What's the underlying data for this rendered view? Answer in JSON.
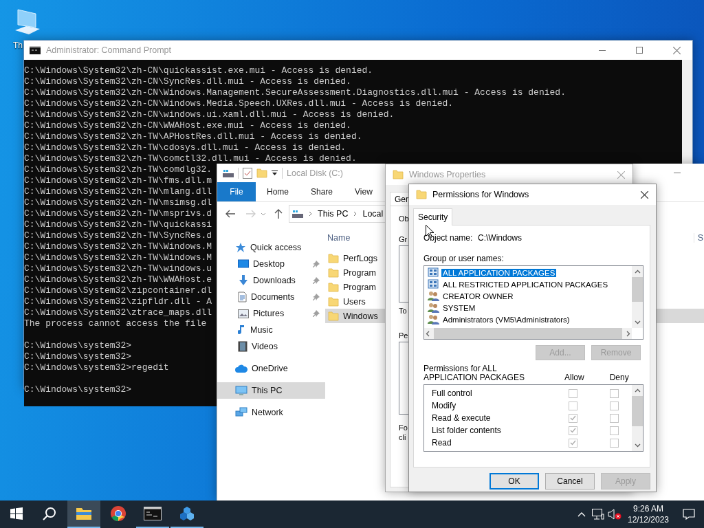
{
  "desktop_icons": [
    {
      "label": "Th"
    }
  ],
  "command_prompt": {
    "title": "Administrator: Command Prompt",
    "blocks": [
      [
        "C:\\Windows\\System32\\zh-CN\\quickassist.exe.mui - Access is denied.",
        "C:\\Windows\\System32\\zh-CN\\SyncRes.dll.mui - Access is denied.",
        "C:\\Windows\\System32\\zh-CN\\Windows.Management.SecureAssessment.Diagnostics.dll.mui - Access is denied.",
        "C:\\Windows\\System32\\zh-CN\\Windows.Media.Speech.UXRes.dll.mui - Access is denied.",
        "C:\\Windows\\System32\\zh-CN\\windows.ui.xaml.dll.mui - Access is denied.",
        "C:\\Windows\\System32\\zh-CN\\WWAHost.exe.mui - Access is denied.",
        "C:\\Windows\\System32\\zh-TW\\APHostRes.dll.mui - Access is denied.",
        "C:\\Windows\\System32\\zh-TW\\cdosys.dll.mui - Access is denied.",
        "C:\\Windows\\System32\\zh-TW\\comctl32.dll.mui - Access is denied.",
        "C:\\Windows\\System32\\zh-TW\\comdlg32.",
        "C:\\Windows\\System32\\zh-TW\\fms.dll.m",
        "C:\\Windows\\System32\\zh-TW\\mlang.dll",
        "C:\\Windows\\System32\\zh-TW\\msimsg.dl",
        "C:\\Windows\\System32\\zh-TW\\msprivs.d",
        "C:\\Windows\\System32\\zh-TW\\quickassi",
        "C:\\Windows\\System32\\zh-TW\\SyncRes.d",
        "C:\\Windows\\System32\\zh-TW\\Windows.M",
        "C:\\Windows\\System32\\zh-TW\\Windows.M",
        "C:\\Windows\\System32\\zh-TW\\windows.u",
        "C:\\Windows\\System32\\zh-TW\\WWAHost.e",
        "C:\\Windows\\System32\\zipcontainer.dl",
        "C:\\Windows\\System32\\zipfldr.dll - A",
        "C:\\Windows\\System32\\ztrace_maps.dll",
        "The process cannot access the file"
      ],
      [
        "C:\\Windows\\system32>",
        "C:\\Windows\\system32>",
        "C:\\Windows\\system32>regedit"
      ],
      [
        "C:\\Windows\\system32>"
      ]
    ]
  },
  "explorer": {
    "title": "Local Disk (C:)",
    "ribbon_tabs": [
      {
        "label": "File",
        "selected": true
      },
      {
        "label": "Home",
        "selected": false
      },
      {
        "label": "Share",
        "selected": false
      },
      {
        "label": "View",
        "selected": false
      }
    ],
    "address": [
      "This PC",
      "Local"
    ],
    "nav": [
      {
        "label": "Quick access",
        "selected": false,
        "children": [
          {
            "label": "Desktop",
            "pinned": true,
            "selected": false
          },
          {
            "label": "Downloads",
            "pinned": true,
            "selected": false
          },
          {
            "label": "Documents",
            "pinned": true,
            "selected": false
          },
          {
            "label": "Pictures",
            "pinned": true,
            "selected": false
          },
          {
            "label": "Music",
            "pinned": false,
            "selected": false
          },
          {
            "label": "Videos",
            "pinned": false,
            "selected": false
          }
        ]
      },
      {
        "label": "OneDrive",
        "selected": false
      },
      {
        "label": "This PC",
        "selected": true
      },
      {
        "label": "Network",
        "selected": false
      }
    ],
    "columns": [
      "Name",
      "S"
    ],
    "files": [
      {
        "name": "PerfLogs",
        "selected": false
      },
      {
        "name": "Program",
        "selected": false
      },
      {
        "name": "Program",
        "selected": false
      },
      {
        "name": "Users",
        "selected": false
      },
      {
        "name": "Windows",
        "selected": true
      }
    ]
  },
  "properties": {
    "title": "Windows Properties",
    "tabs": [
      {
        "label": "Gen"
      }
    ],
    "labels": [
      "Ob",
      "Gr",
      "To",
      "Pe",
      "Fo",
      "cli"
    ]
  },
  "permissions": {
    "title": "Permissions for Windows",
    "tabs": [
      {
        "label": "Security",
        "selected": true
      }
    ],
    "object_label": "Object name:",
    "object_value": "C:\\Windows",
    "group_label": "Group or user names:",
    "users": [
      {
        "name": "ALL APPLICATION PACKAGES",
        "kind": "package",
        "selected": true
      },
      {
        "name": "ALL RESTRICTED APPLICATION PACKAGES",
        "kind": "package",
        "selected": false
      },
      {
        "name": "CREATOR OWNER",
        "kind": "group",
        "selected": false
      },
      {
        "name": "SYSTEM",
        "kind": "group",
        "selected": false
      },
      {
        "name": "Administrators (VM5\\Administrators)",
        "kind": "group",
        "selected": false
      }
    ],
    "user_buttons": [
      {
        "label": "Add...",
        "disabled": true
      },
      {
        "label": "Remove",
        "disabled": true
      }
    ],
    "perm_label": "Permissions for ALL APPLICATION PACKAGES",
    "allow_label": "Allow",
    "deny_label": "Deny",
    "perms": [
      {
        "name": "Full control",
        "allow": false,
        "deny": false
      },
      {
        "name": "Modify",
        "allow": false,
        "deny": false
      },
      {
        "name": "Read & execute",
        "allow": true,
        "deny": false
      },
      {
        "name": "List folder contents",
        "allow": true,
        "deny": false
      },
      {
        "name": "Read",
        "allow": true,
        "deny": false
      }
    ],
    "buttons": [
      {
        "label": "OK",
        "default": true,
        "disabled": false
      },
      {
        "label": "Cancel",
        "default": false,
        "disabled": false
      },
      {
        "label": "Apply",
        "default": false,
        "disabled": true
      }
    ]
  },
  "taskbar": {
    "apps": [
      {
        "running": true,
        "active": true
      },
      {
        "running": false,
        "active": false
      },
      {
        "running": true,
        "active": false
      },
      {
        "running": true,
        "active": false
      }
    ],
    "time": "9:26 AM",
    "date": "12/12/2023"
  }
}
